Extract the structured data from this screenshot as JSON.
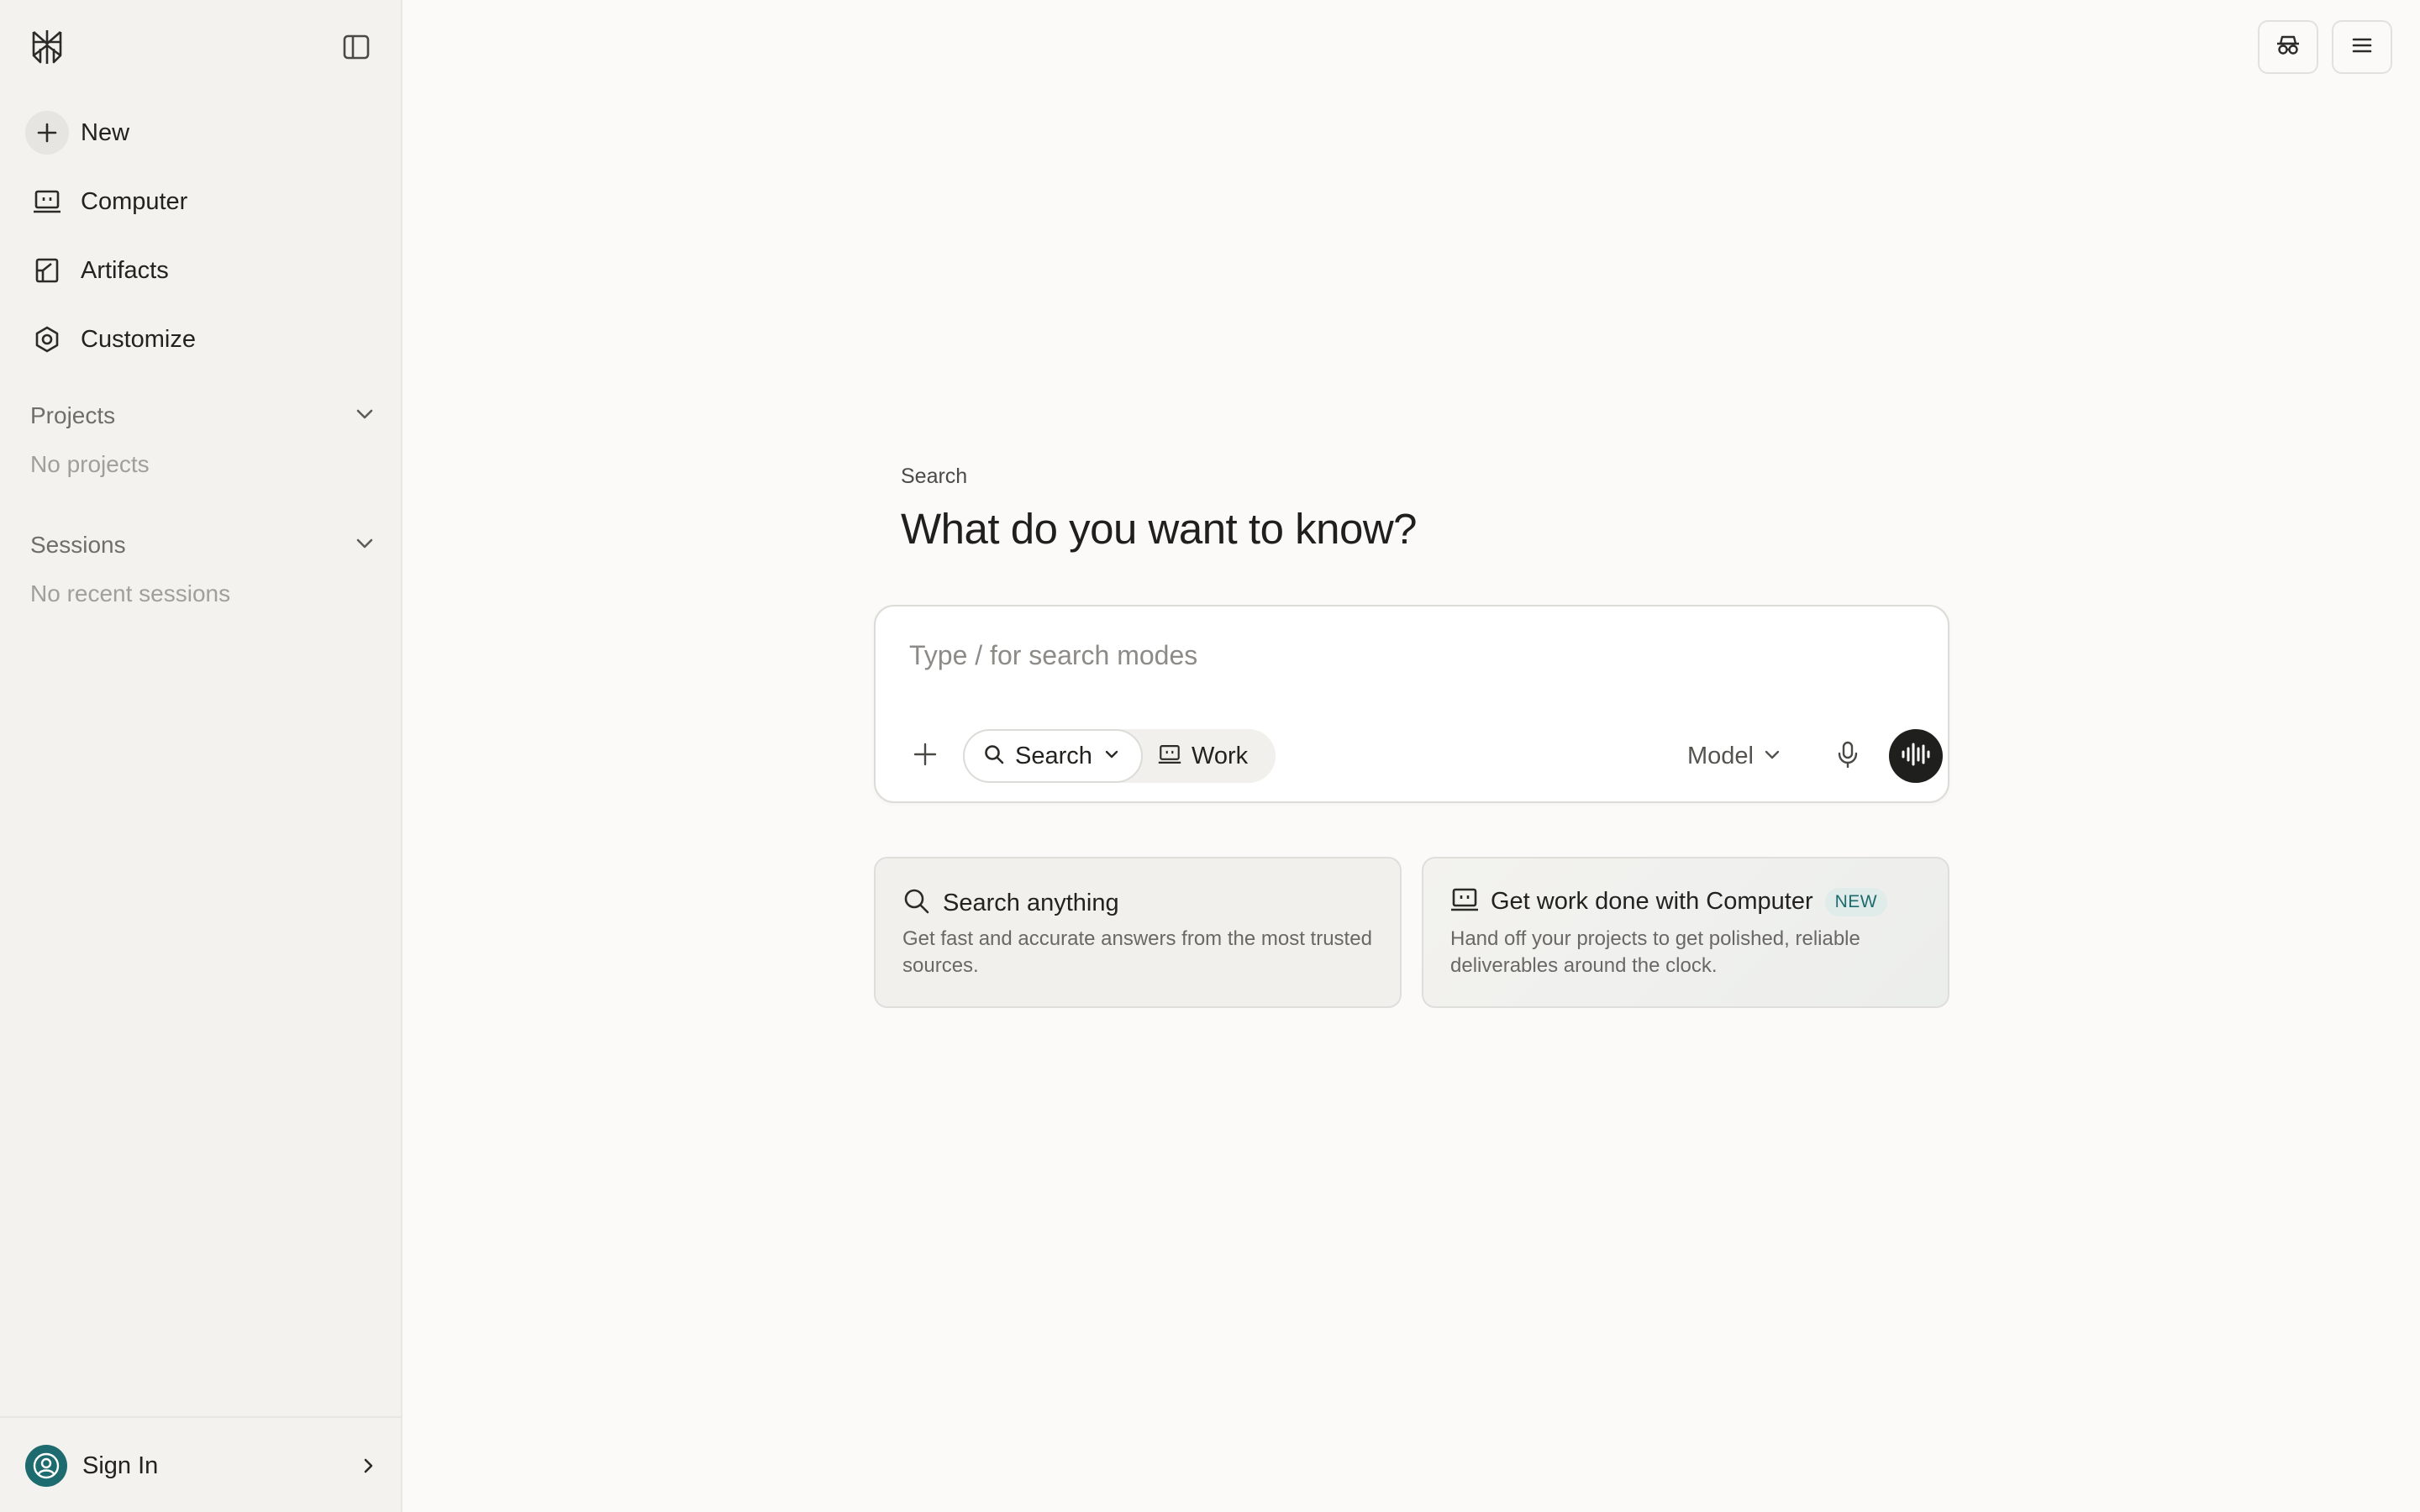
{
  "sidebar": {
    "logo_icon": "perplexity-logo-icon",
    "collapse_icon": "sidebar-toggle-icon",
    "nav": [
      {
        "label": "New",
        "icon": "plus-icon"
      },
      {
        "label": "Computer",
        "icon": "computer-icon"
      },
      {
        "label": "Artifacts",
        "icon": "artifacts-icon"
      },
      {
        "label": "Customize",
        "icon": "customize-icon"
      }
    ],
    "projects": {
      "title": "Projects",
      "empty": "No projects"
    },
    "sessions": {
      "title": "Sessions",
      "empty": "No recent sessions"
    },
    "signin": {
      "label": "Sign In",
      "icon": "user-circle-icon"
    }
  },
  "topbar": {
    "incognito_icon": "incognito-icon",
    "menu_icon": "hamburger-menu-icon"
  },
  "hero": {
    "kicker": "Search",
    "title": "What do you want to know?"
  },
  "input": {
    "placeholder": "Type / for search modes",
    "value": "",
    "modes": [
      {
        "label": "Search",
        "icon": "search-icon",
        "selected": true
      },
      {
        "label": "Work",
        "icon": "computer-icon",
        "selected": false
      }
    ],
    "model_label": "Model"
  },
  "cards": [
    {
      "title": "Search anything",
      "desc": "Get fast and accurate answers from the most trusted sources.",
      "icon": "search-icon"
    },
    {
      "title": "Get work done with Computer",
      "badge": "NEW",
      "desc": "Hand off your projects to get polished, reliable deliverables around the clock.",
      "icon": "computer-icon"
    }
  ],
  "colors": {
    "background": "#fbfaf8",
    "sidebar": "#f3f2ef",
    "accent_teal": "#1d6b6f",
    "text": "#1f1f1d"
  }
}
